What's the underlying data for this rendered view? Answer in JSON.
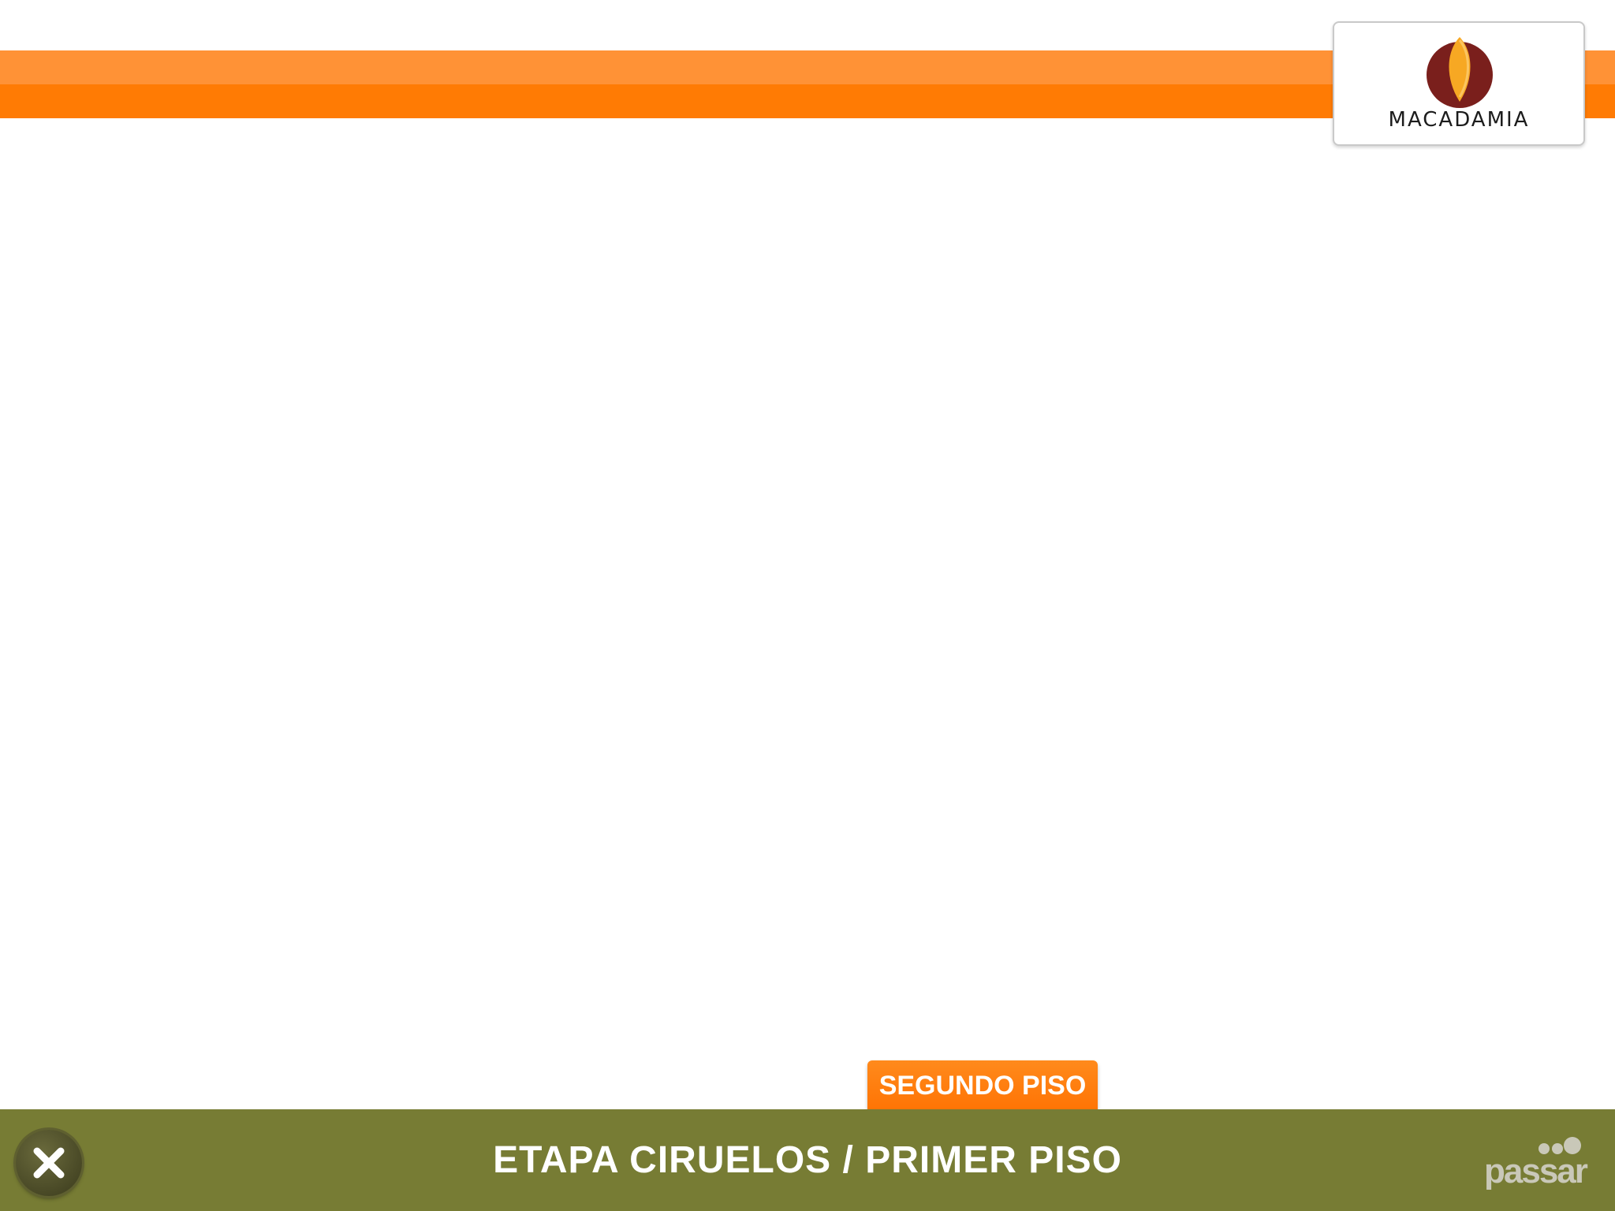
{
  "brand": {
    "name": "MACADAMIA",
    "colors": {
      "accent": "#ff7b04",
      "accent_light": "#ff9236",
      "footer": "#777c34",
      "logo_dark": "#7a1f1c",
      "logo_light": "#f7a823"
    }
  },
  "floor_tab": {
    "label": "SEGUNDO PISO"
  },
  "footer": {
    "title": "ETAPA CIRUELOS / PRIMER PISO",
    "close_icon": "close-icon",
    "partner_logo": "passar"
  }
}
